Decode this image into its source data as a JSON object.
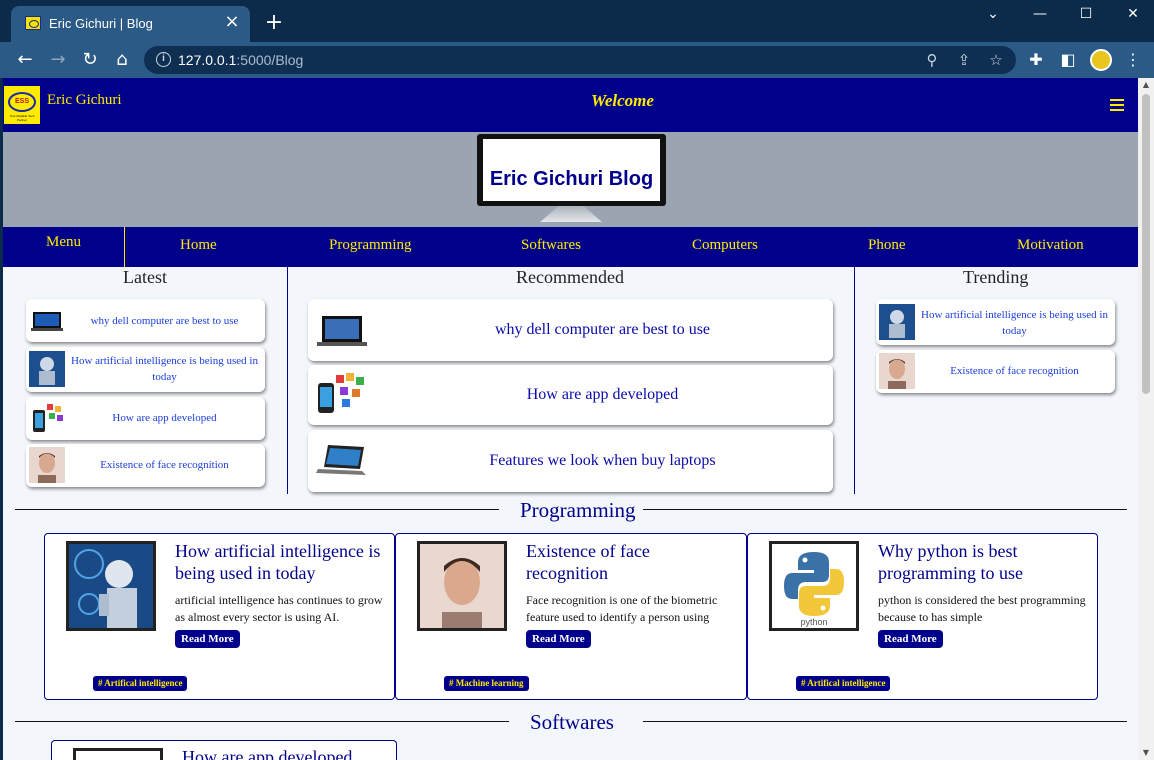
{
  "browser": {
    "tab_title": "Eric Gichuri | Blog",
    "url_host": "127.0.0.1",
    "url_path": ":5000/Blog"
  },
  "header": {
    "brand": "Eric Gichuri",
    "welcome": "Welcome",
    "logo_text": "ESS",
    "logo_tagline": "Your Reliable Tech Partner"
  },
  "banner": {
    "title": "Eric Gichuri Blog"
  },
  "nav": {
    "menu": "Menu",
    "items": [
      "Home",
      "Programming",
      "Softwares",
      "Computers",
      "Phone",
      "Motivation"
    ]
  },
  "latest": {
    "heading": "Latest",
    "items": [
      {
        "title": "why dell computer are best to use",
        "icon": "laptop-thumbnail"
      },
      {
        "title": "How artificial intelligence is being used in today",
        "icon": "robot-thumbnail"
      },
      {
        "title": "How are app developed",
        "icon": "phone-apps-thumbnail"
      },
      {
        "title": "Existence of face recognition",
        "icon": "face-thumbnail"
      }
    ]
  },
  "recommended": {
    "heading": "Recommended",
    "items": [
      {
        "title": "why dell computer are best to use",
        "icon": "laptop-thumbnail"
      },
      {
        "title": "How are app developed",
        "icon": "phone-apps-thumbnail"
      },
      {
        "title": "Features we look when buy laptops",
        "icon": "laptop-thumbnail"
      }
    ]
  },
  "trending": {
    "heading": "Trending",
    "items": [
      {
        "title": "How artificial intelligence is being used in today",
        "icon": "robot-thumbnail"
      },
      {
        "title": "Existence of face recognition",
        "icon": "face-thumbnail"
      }
    ]
  },
  "programming": {
    "heading": "Programming",
    "posts": [
      {
        "title": "How artificial intelligence is being used in today",
        "excerpt": "artificial intelligence has continues to grow as almost every sector is using AI.",
        "read_more": "Read More",
        "tag": "# Artifical intelligence"
      },
      {
        "title": "Existence of face recognition",
        "excerpt": "Face recognition is one of the biometric feature used to identify a person using",
        "read_more": "Read More",
        "tag": "# Machine learning"
      },
      {
        "title": "Why python is best programming to use",
        "excerpt": "python is considered the best programming because to has simple",
        "read_more": "Read More",
        "tag": "# Artifical intelligence",
        "image_label": "python"
      }
    ]
  },
  "softwares": {
    "heading": "Softwares",
    "next_post_fragment": "How are app developed"
  },
  "colors": {
    "primary": "#00008b",
    "accent": "#ffeb00",
    "link": "#1a3ed8",
    "chrome": "#0c2a4a"
  }
}
